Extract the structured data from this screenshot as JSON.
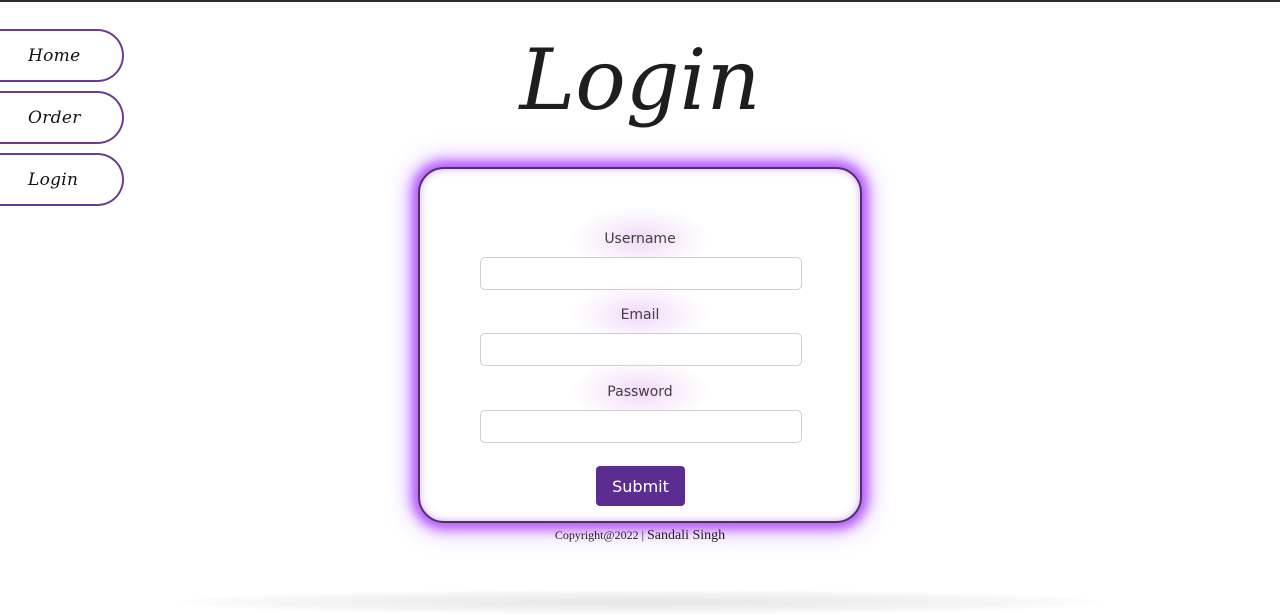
{
  "nav": {
    "items": [
      {
        "label": "Home"
      },
      {
        "label": "Order"
      },
      {
        "label": "Login"
      }
    ]
  },
  "page": {
    "title": "Login"
  },
  "form": {
    "username_label": "Username",
    "username_value": "",
    "email_label": "Email",
    "email_value": "",
    "password_label": "Password",
    "password_value": "",
    "submit_label": "Submit"
  },
  "footer": {
    "copyright": "Copyright@2022 |",
    "author": "Sandali Singh"
  },
  "colors": {
    "accent": "#5c2d91",
    "glow": "#b250ff",
    "nav_border": "#6a3d8f"
  }
}
